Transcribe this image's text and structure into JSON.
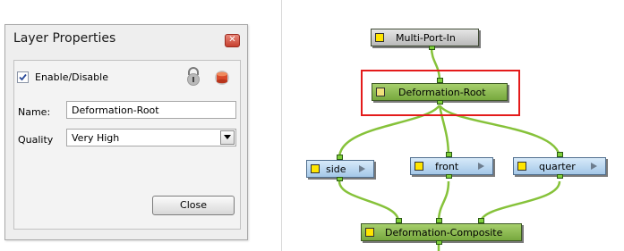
{
  "dialog": {
    "title": "Layer Properties",
    "close_icon_glyph": "✕",
    "enable_checked": true,
    "enable_label": "Enable/Disable",
    "name_label": "Name:",
    "name_value": "Deformation-Root",
    "quality_label": "Quality",
    "quality_value": "Very High",
    "close_button": "Close",
    "icons": [
      "lock-icon",
      "database-icon",
      "dropdown-arrow-icon",
      "close-icon"
    ]
  },
  "node_view": {
    "nodes": [
      {
        "id": "multi-port-in",
        "label": "Multi-Port-In",
        "color": "gray",
        "selected": false
      },
      {
        "id": "deformation-root",
        "label": "Deformation-Root",
        "color": "green",
        "selected": true
      },
      {
        "id": "side",
        "label": "side",
        "color": "blue"
      },
      {
        "id": "front",
        "label": "front",
        "color": "blue"
      },
      {
        "id": "quarter",
        "label": "quarter",
        "color": "blue"
      },
      {
        "id": "deformation-composite",
        "label": "Deformation-Composite",
        "color": "green"
      }
    ],
    "colors": {
      "wire": "#86c23a",
      "selection": "#e41b1b",
      "group_green": "#8cbf52",
      "drawing_blue": "#b9d7f1",
      "port": "#7fcf3a"
    }
  }
}
